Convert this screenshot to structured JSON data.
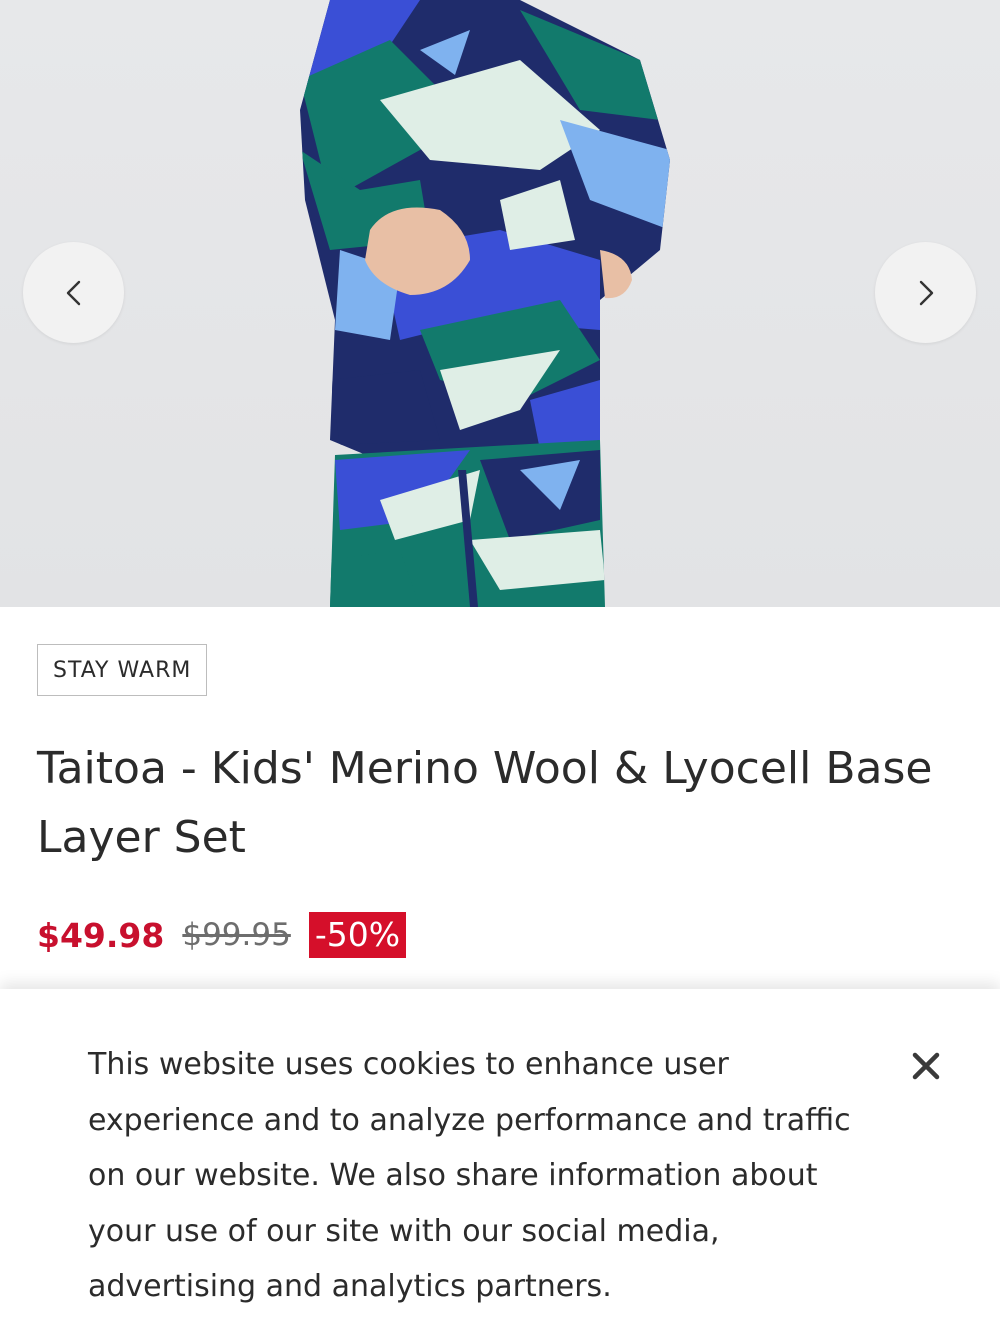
{
  "carousel": {
    "prev_icon": "chevron-left-icon",
    "next_icon": "chevron-right-icon",
    "image_alt": "Child wearing a blue, green and white patterned base layer set"
  },
  "product": {
    "tag": "STAY WARM",
    "title": "Taitoa - Kids' Merino Wool & Lyocell Base Layer Set",
    "price_current": "$49.98",
    "price_original": "$99.95",
    "discount": "-50%"
  },
  "cookie_banner": {
    "text": "This website uses cookies to enhance user experience and to analyze performance and traffic on our website. We also share information about your use of our site with our social media, advertising and analytics partners.",
    "close_icon": "close-icon"
  },
  "colors": {
    "sale_red": "#c8102e",
    "badge_red": "#d50f2a",
    "navy": "#1f2c6b",
    "royal_blue": "#3a4fd6",
    "teal": "#127a6c",
    "sky_blue": "#7fb2ef",
    "mint_white": "#dfeee6"
  }
}
